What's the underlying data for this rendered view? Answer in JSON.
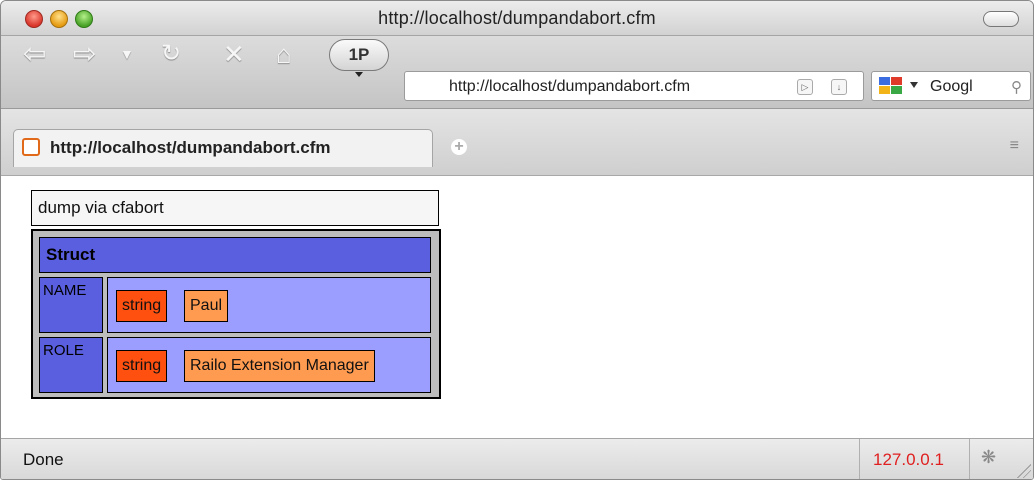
{
  "window": {
    "title": "http://localhost/dumpandabort.cfm"
  },
  "toolbar": {
    "onepassword_label": "1P",
    "url_value": "http://localhost/dumpandabort.cfm",
    "search_value": "Googl"
  },
  "tabs": [
    {
      "label": "http://localhost/dumpandabort.cfm"
    }
  ],
  "dump": {
    "heading": "dump via cfabort",
    "struct_label": "Struct",
    "rows": [
      {
        "key": "NAME",
        "type": "string",
        "value": "Paul"
      },
      {
        "key": "ROLE",
        "type": "string",
        "value": "Railo Extension Manager"
      }
    ]
  },
  "status": {
    "text": "Done",
    "host": "127.0.0.1"
  },
  "colors": {
    "struct_header": "#5a5fe0",
    "struct_value_bg": "#9b9dff",
    "string_type": "#ff5010",
    "string_value": "#ff9b50",
    "status_host": "#e02020"
  },
  "icons": {
    "back": "back-arrow-icon",
    "forward": "forward-arrow-icon",
    "history": "history-dropdown-icon",
    "reload": "reload-icon",
    "stop": "stop-icon",
    "home": "home-icon",
    "rss": "rss-icon",
    "bookmark": "bookmark-icon",
    "search_engine": "google-icon",
    "magnifier": "magnifier-icon",
    "favicon": "page-favicon-icon",
    "new_tab": "plus-icon",
    "tab_list": "tab-list-icon",
    "firebug": "bug-icon"
  }
}
